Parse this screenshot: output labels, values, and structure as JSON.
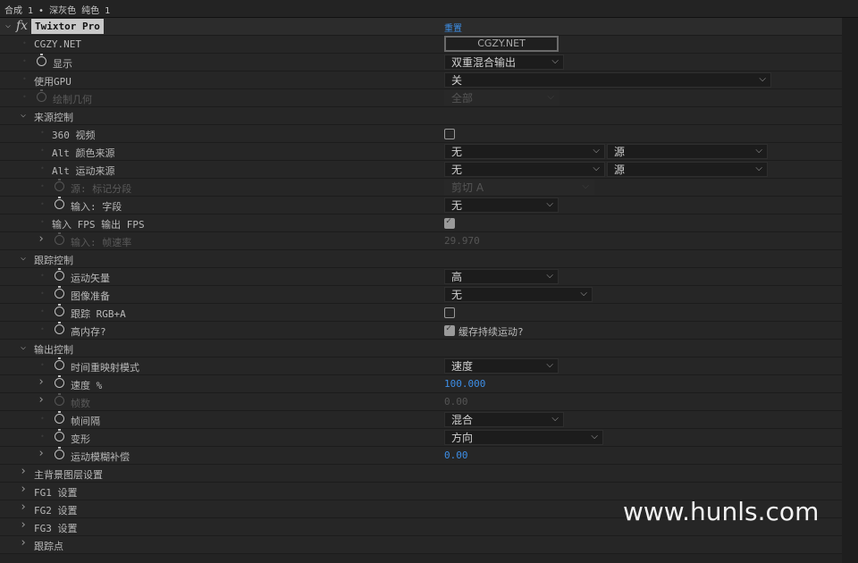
{
  "breadcrumb": "合成 1 • 深灰色 纯色 1",
  "effect": {
    "name": "Twixtor Pro",
    "fx_label": "fx",
    "reset_label": "重置"
  },
  "watermark": "www.hunls.com",
  "colors": {
    "accent": "#3d8ee6",
    "background": "#232323"
  },
  "rows": [
    {
      "level": 1,
      "label": "CGZY.NET",
      "control": {
        "type": "button",
        "value": "CGZY.NET"
      }
    },
    {
      "level": 1,
      "stopwatch": true,
      "label": "显示",
      "control": {
        "type": "dropdown",
        "value": "双重混合输出"
      }
    },
    {
      "level": 1,
      "label": "使用GPU",
      "control": {
        "type": "dropdown",
        "value": "关"
      }
    },
    {
      "level": 1,
      "stopwatch": true,
      "disabled": true,
      "label": "绘制几何",
      "control": {
        "type": "dropdown",
        "value": "全部",
        "disabled": true
      }
    },
    {
      "level": 1,
      "twirl": "open",
      "label": "来源控制"
    },
    {
      "level": 2,
      "label": "360 视频",
      "control": {
        "type": "checkbox",
        "checked": false
      }
    },
    {
      "level": 2,
      "label": "Alt 颜色来源",
      "control": {
        "type": "dropdown2",
        "value": "无",
        "value2": "源"
      }
    },
    {
      "level": 2,
      "label": "Alt 运动来源",
      "control": {
        "type": "dropdown2",
        "value": "无",
        "value2": "源"
      }
    },
    {
      "level": 2,
      "stopwatch": true,
      "disabled": true,
      "label": "源: 标记分段",
      "control": {
        "type": "dropdown",
        "value": "剪切 A",
        "disabled": true
      }
    },
    {
      "level": 2,
      "stopwatch": true,
      "label": "输入: 字段",
      "control": {
        "type": "dropdown",
        "value": "无"
      }
    },
    {
      "level": 2,
      "label": "输入 FPS 输出 FPS",
      "control": {
        "type": "checkbox",
        "checked": true
      }
    },
    {
      "level": 2,
      "twirl": "closed",
      "stopwatch": true,
      "disabled": true,
      "label": "输入: 帧速率",
      "control": {
        "type": "number",
        "value": "29.970",
        "disabled": true
      }
    },
    {
      "level": 1,
      "twirl": "open",
      "label": "跟踪控制"
    },
    {
      "level": 2,
      "stopwatch": true,
      "label": "运动矢量",
      "control": {
        "type": "dropdown",
        "value": "高"
      }
    },
    {
      "level": 2,
      "stopwatch": true,
      "label": "图像准备",
      "control": {
        "type": "dropdown",
        "value": "无"
      }
    },
    {
      "level": 2,
      "stopwatch": true,
      "label": "跟踪 RGB+A",
      "control": {
        "type": "checkbox",
        "checked": false
      }
    },
    {
      "level": 2,
      "stopwatch": true,
      "label": "高内存?",
      "control": {
        "type": "checkbox",
        "checked": true,
        "label": "缓存持续运动?"
      }
    },
    {
      "level": 1,
      "twirl": "open",
      "label": "输出控制"
    },
    {
      "level": 2,
      "stopwatch": true,
      "label": "时间重映射模式",
      "control": {
        "type": "dropdown",
        "value": "速度"
      }
    },
    {
      "level": 2,
      "twirl": "closed",
      "stopwatch": true,
      "label": "速度 %",
      "control": {
        "type": "number",
        "value": "100.000"
      }
    },
    {
      "level": 2,
      "twirl": "closed",
      "stopwatch": true,
      "disabled": true,
      "label": "帧数",
      "control": {
        "type": "number",
        "value": "0.00",
        "disabled": true
      }
    },
    {
      "level": 2,
      "stopwatch": true,
      "label": "帧间隔",
      "control": {
        "type": "dropdown",
        "value": "混合"
      }
    },
    {
      "level": 2,
      "stopwatch": true,
      "label": "变形",
      "control": {
        "type": "dropdown",
        "value": "方向"
      }
    },
    {
      "level": 2,
      "twirl": "closed",
      "stopwatch": true,
      "label": "运动模糊补偿",
      "control": {
        "type": "number",
        "value": "0.00"
      }
    },
    {
      "level": 1,
      "twirl": "closed",
      "label": "主背景图层设置"
    },
    {
      "level": 1,
      "twirl": "closed",
      "label": "FG1 设置"
    },
    {
      "level": 1,
      "twirl": "closed",
      "label": "FG2 设置"
    },
    {
      "level": 1,
      "twirl": "closed",
      "label": "FG3 设置"
    },
    {
      "level": 1,
      "twirl": "closed",
      "label": "跟踪点"
    }
  ]
}
